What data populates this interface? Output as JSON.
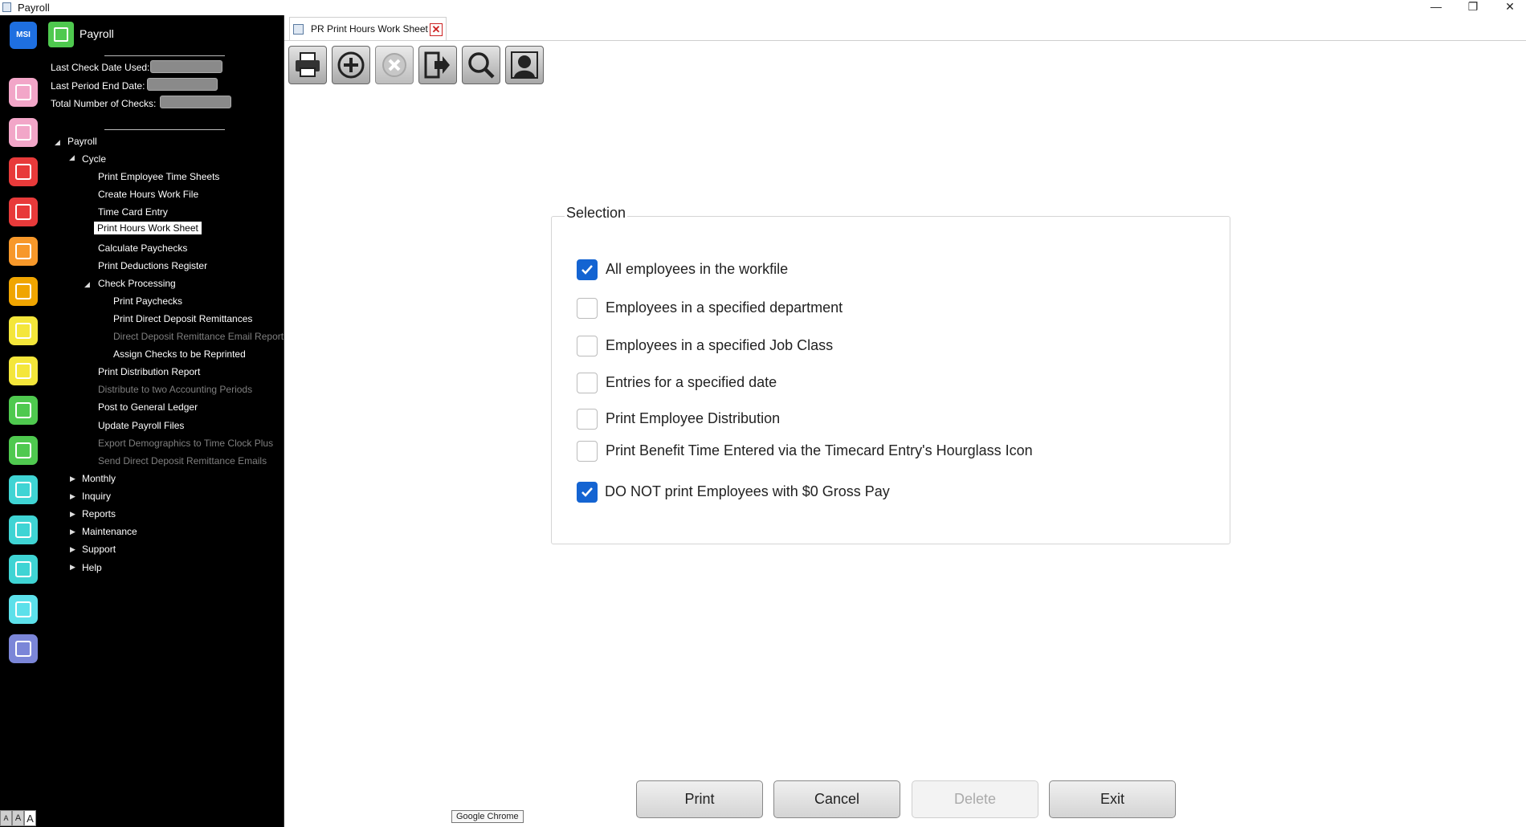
{
  "window": {
    "title": "Payroll",
    "controls": {
      "minimize": "—",
      "restore": "❐",
      "close": "✕"
    }
  },
  "sidebar": {
    "msi_label": "MSI",
    "module_title": "Payroll",
    "info": {
      "last_check_date_label": "Last Check Date Used:",
      "last_period_end_label": "Last Period End Date:",
      "total_checks_label": "Total Number of Checks:"
    },
    "tree": {
      "payroll": "Payroll",
      "cycle": "Cycle",
      "print_employee_time_sheets": "Print Employee Time Sheets",
      "create_hours_work_file": "Create Hours Work File",
      "time_card_entry": "Time Card Entry",
      "print_hours_work_sheet": "Print Hours Work Sheet",
      "calculate_paychecks": "Calculate Paychecks",
      "print_deductions_register": "Print Deductions Register",
      "check_processing": "Check Processing",
      "print_paychecks": "Print Paychecks",
      "print_direct_deposit_remittances": "Print Direct Deposit Remittances",
      "direct_deposit_remittance_email_report": "Direct Deposit Remittance Email Report",
      "assign_checks_to_be_reprinted": "Assign Checks to be Reprinted",
      "print_distribution_report": "Print Distribution Report",
      "distribute_to_two_accounting_periods": "Distribute to two Accounting Periods",
      "post_to_general_ledger": "Post to General Ledger",
      "update_payroll_files": "Update Payroll Files",
      "export_demographics": "Export Demographics to Time Clock Plus",
      "send_direct_deposit_emails": "Send Direct Deposit Remittance Emails",
      "monthly": "Monthly",
      "inquiry": "Inquiry",
      "reports": "Reports",
      "maintenance": "Maintenance",
      "support": "Support",
      "help": "Help"
    },
    "font_size_buttons": [
      "A",
      "A",
      "A"
    ],
    "rail_colors": [
      "#f2a6c8",
      "#f2a6c8",
      "#e83a3a",
      "#e83a3a",
      "#f7982a",
      "#f0a500",
      "#f4e63a",
      "#f4e63a",
      "#4fc94f",
      "#4fc94f",
      "#3fd4d4",
      "#3fd4d4",
      "#3fd4d4",
      "#5ce0ea",
      "#7b86d8"
    ]
  },
  "tab": {
    "label": "PR Print Hours Work Sheet"
  },
  "toolbar": {
    "buttons": [
      "print-icon",
      "add-icon",
      "cancel-icon",
      "exit-icon",
      "search-icon",
      "user-icon"
    ]
  },
  "selection": {
    "legend": "Selection",
    "options": [
      {
        "label": "All employees in the workfile",
        "checked": true
      },
      {
        "label": "Employees in a specified department",
        "checked": false
      },
      {
        "label": "Employees in a specified Job Class",
        "checked": false
      },
      {
        "label": "Entries for a specified date",
        "checked": false
      },
      {
        "label": "Print Employee Distribution",
        "checked": false
      },
      {
        "label": "Print Benefit Time Entered via the Timecard Entry's Hourglass Icon",
        "checked": false
      },
      {
        "label": "DO NOT print Employees with $0 Gross Pay",
        "checked": true
      }
    ]
  },
  "actions": {
    "print": "Print",
    "cancel": "Cancel",
    "delete": "Delete",
    "exit": "Exit"
  },
  "tooltip": "Google Chrome"
}
